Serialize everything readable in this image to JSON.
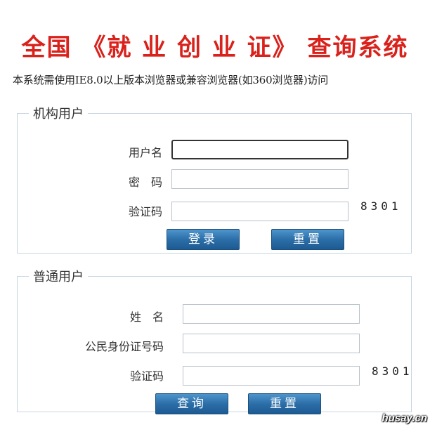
{
  "page": {
    "title": "全国 《就 业 创 业 证》 查询系统",
    "notice": "本系统需使用IE8.0以上版本浏览器或兼容浏览器(如360浏览器)访问",
    "watermark": "husay.cn"
  },
  "org_section": {
    "legend": "机构用户",
    "username_label": "用户名",
    "username_value": "",
    "password_label": "密　码",
    "password_value": "",
    "captcha_label": "验证码",
    "captcha_value": "",
    "captcha_code": "8301",
    "login_button": "登录",
    "reset_button": "重置"
  },
  "public_section": {
    "legend": "普通用户",
    "name_label": "姓　名",
    "name_value": "",
    "id_label": "公民身份证号码",
    "id_value": "",
    "captcha_label": "验证码",
    "captcha_value": "",
    "captcha_code": "8301",
    "query_button": "查询",
    "reset_button": "重置"
  },
  "colors": {
    "title_red": "#d9221c",
    "button_blue": "#2c6ea8",
    "border": "#c8d4e0"
  }
}
